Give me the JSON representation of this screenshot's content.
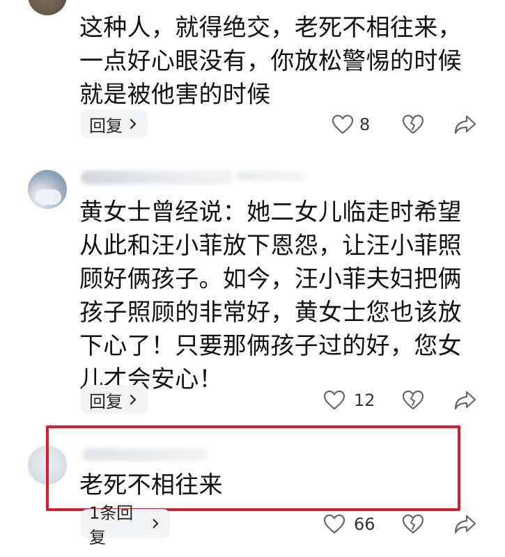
{
  "comments": [
    {
      "text": "这种人，就得绝交，老死不相往来，一点好心眼没有，你放松警惕的时候就是被他害的时候",
      "reply_label": "回复",
      "likes": "8"
    },
    {
      "text": "黄女士曾经说：她二女儿临走时希望从此和汪小菲放下恩怨，让汪小菲照顾好俩孩子。如今，汪小菲夫妇把俩孩子照顾的非常好，黄女士您也该放下心了！只要那俩孩子过的好，您女儿才会安心！",
      "reply_label": "回复",
      "likes": "12"
    },
    {
      "text": "老死不相往来",
      "reply_label": "1条回复",
      "likes": "66"
    }
  ],
  "icons": {
    "like": "heart-outline-icon",
    "dislike": "broken-heart-icon",
    "share": "share-arrow-icon",
    "reply_chevron": "chevron-right-icon"
  },
  "colors": {
    "highlight_border": "#d81e2e",
    "reply_bg": "#f3f4f6",
    "icon_stroke": "#666666",
    "text": "#111111"
  }
}
